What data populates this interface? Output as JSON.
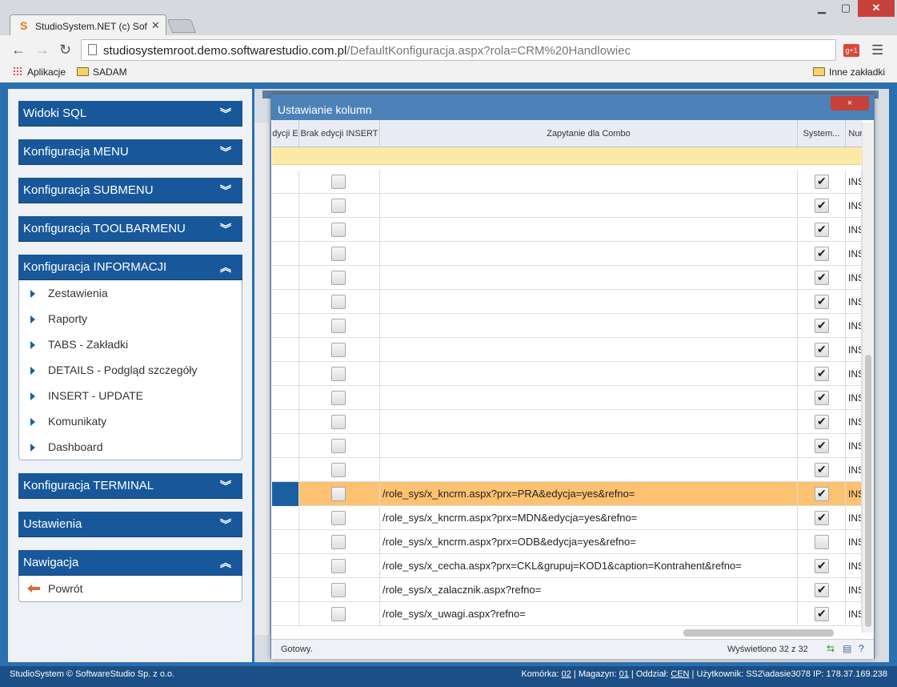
{
  "browser": {
    "tab_title": "StudioSystem.NET (c) Soft",
    "address_host": "studiosystemroot.demo.softwarestudio.com.pl",
    "address_path": "/DefaultKonfiguracja.aspx?rola=CRM%20Handlowiec",
    "bookmarks": {
      "apps": "Aplikacje",
      "sadam": "SADAM",
      "other": "Inne zakładki"
    }
  },
  "sidebar": {
    "sections": [
      {
        "title": "Widoki SQL"
      },
      {
        "title": "Konfiguracja MENU"
      },
      {
        "title": "Konfiguracja SUBMENU"
      },
      {
        "title": "Konfiguracja TOOLBARMENU"
      },
      {
        "title": "Konfiguracja INFORMACJI"
      },
      {
        "title": "Konfiguracja TERMINAL"
      },
      {
        "title": "Ustawienia"
      },
      {
        "title": "Nawigacja"
      }
    ],
    "informacji_items": [
      {
        "label": "Zestawienia"
      },
      {
        "label": "Raporty"
      },
      {
        "label": "TABS - Zakładki"
      },
      {
        "label": "DETAILS - Podgląd szczegóły"
      },
      {
        "label": "INSERT - UPDATE"
      },
      {
        "label": "Komunikaty"
      },
      {
        "label": "Dashboard"
      }
    ],
    "nav_items": [
      {
        "label": "Powrót"
      }
    ]
  },
  "dialog": {
    "title": "Ustawianie kolumn",
    "close": "×",
    "columns": {
      "partial": "dycji E",
      "brak_edycji": "Brak edycji INSERT",
      "zapytanie": "Zapytanie dla Combo",
      "system": "System...",
      "num": "Num"
    },
    "rows": [
      {
        "combo": "",
        "brak": false,
        "system": true,
        "num": "INS"
      },
      {
        "combo": "",
        "brak": false,
        "system": true,
        "num": "INS"
      },
      {
        "combo": "",
        "brak": false,
        "system": true,
        "num": "INS"
      },
      {
        "combo": "",
        "brak": false,
        "system": true,
        "num": "INS"
      },
      {
        "combo": "",
        "brak": false,
        "system": true,
        "num": "INS"
      },
      {
        "combo": "",
        "brak": false,
        "system": true,
        "num": "INS"
      },
      {
        "combo": "",
        "brak": false,
        "system": true,
        "num": "INS"
      },
      {
        "combo": "",
        "brak": false,
        "system": true,
        "num": "INS"
      },
      {
        "combo": "",
        "brak": false,
        "system": true,
        "num": "INS"
      },
      {
        "combo": "",
        "brak": false,
        "system": true,
        "num": "INS"
      },
      {
        "combo": "",
        "brak": false,
        "system": true,
        "num": "INS"
      },
      {
        "combo": "",
        "brak": false,
        "system": true,
        "num": "INS"
      },
      {
        "combo": "",
        "brak": false,
        "system": true,
        "num": "INS"
      },
      {
        "combo": "/role_sys/x_kncrm.aspx?prx=PRA&edycja=yes&refno=",
        "brak": false,
        "system": true,
        "num": "INS",
        "selected": true
      },
      {
        "combo": "/role_sys/x_kncrm.aspx?prx=MDN&edycja=yes&refno=",
        "brak": false,
        "system": true,
        "num": "INS"
      },
      {
        "combo": "/role_sys/x_kncrm.aspx?prx=ODB&edycja=yes&refno=",
        "brak": false,
        "system": false,
        "num": "INS"
      },
      {
        "combo": "/role_sys/x_cecha.aspx?prx=CKL&grupuj=KOD1&caption=Kontrahent&refno=",
        "brak": false,
        "system": true,
        "num": "INS"
      },
      {
        "combo": "/role_sys/x_zalacznik.aspx?refno=",
        "brak": false,
        "system": true,
        "num": "INS"
      },
      {
        "combo": "/role_sys/x_uwagi.aspx?refno=",
        "brak": false,
        "system": true,
        "num": "INS"
      }
    ],
    "status_left": "Gotowy.",
    "status_right": "Wyświetlono 32 z 32"
  },
  "footer": {
    "left": "StudioSystem © SoftwareStudio Sp. z o.o.",
    "komorka_label": "Komórka:",
    "komorka": "02",
    "magazyn_label": "Magazyn:",
    "magazyn": "01",
    "oddzial_label": "Oddział:",
    "oddzial": "CEN",
    "uzytkownik_label": "Użytkownik:",
    "uzytkownik": "SS2\\adasie3078",
    "ip_label": "IP:",
    "ip": "178.37.169.238"
  },
  "icons": {
    "favicon": "studiosystem-s-icon",
    "back": "back-arrow-icon",
    "forward": "forward-arrow-icon",
    "reload": "reload-icon",
    "star": "star-icon",
    "menu": "hamburger-menu-icon"
  }
}
